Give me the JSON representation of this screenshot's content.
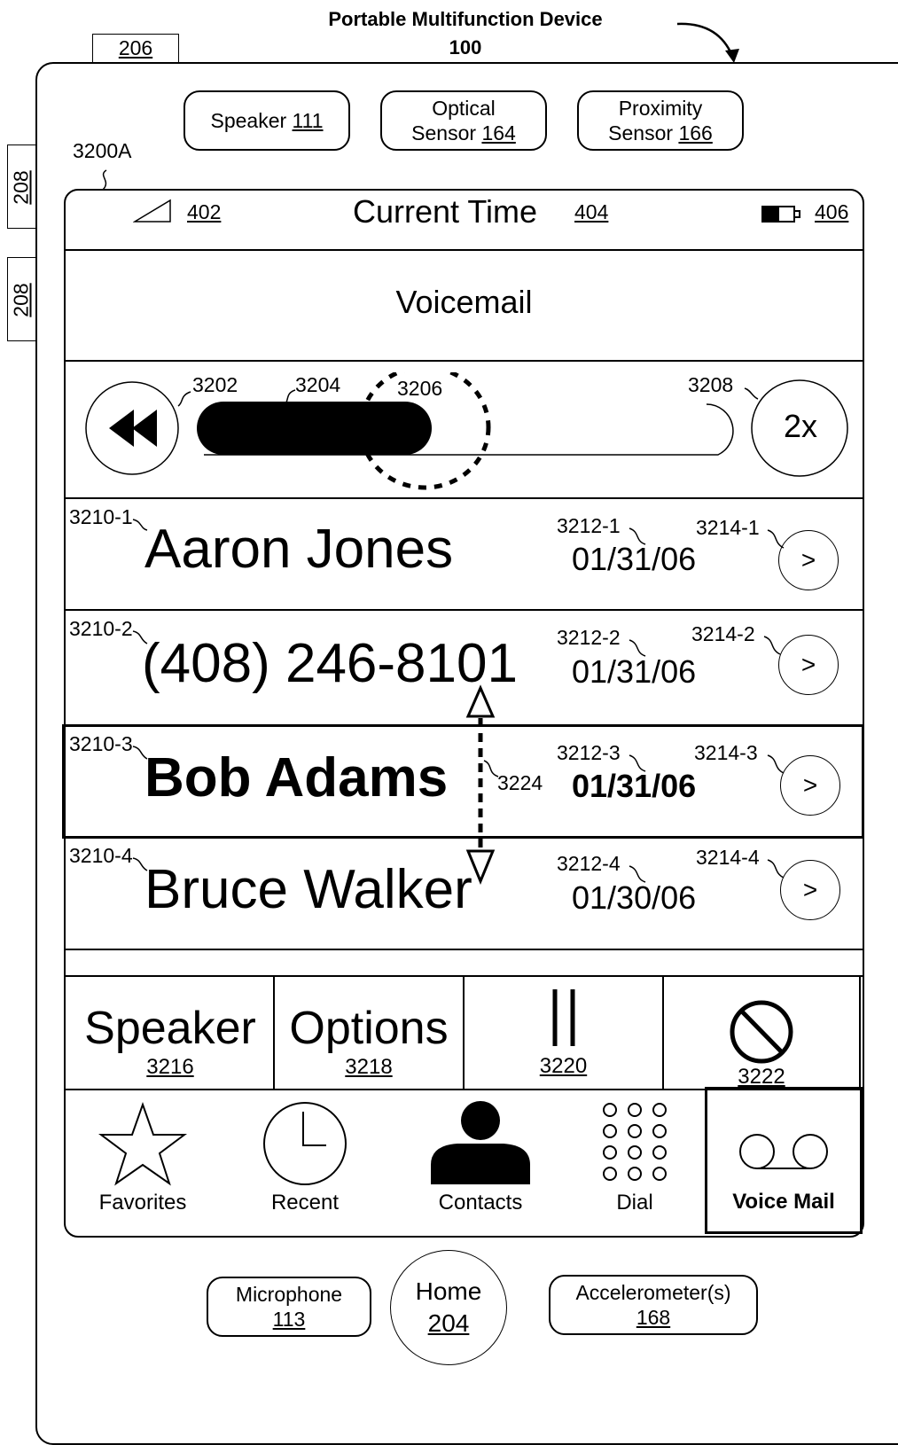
{
  "figure": {
    "title": "Portable Multifunction Device",
    "device_ref": "100",
    "ref_206": "206",
    "ref_208_a": "208",
    "ref_208_b": "208",
    "screen_ref": "3200A"
  },
  "hardware_top": [
    {
      "label": "Speaker",
      "ref": "111"
    },
    {
      "label": "Optical",
      "label2": "Sensor",
      "ref": "164"
    },
    {
      "label": "Proximity",
      "label2": "Sensor",
      "ref": "166"
    }
  ],
  "hardware_bottom": {
    "microphone": {
      "label": "Microphone",
      "ref": "113"
    },
    "home": {
      "label": "Home",
      "ref": "204"
    },
    "accelerometer": {
      "label": "Accelerometer(s)",
      "ref": "168"
    }
  },
  "status_bar": {
    "signal_ref": "402",
    "title": "Current Time",
    "title_ref": "404",
    "battery_ref": "406"
  },
  "header": {
    "title": "Voicemail"
  },
  "playback": {
    "rewind_ref": "3202",
    "progress_ref": "3204",
    "thumb_ref": "3206",
    "track_ref": "3208",
    "speed_label": "2x",
    "progress": 0.45
  },
  "messages": [
    {
      "ref": "3210-1",
      "name": "Aaron Jones",
      "date_ref": "3212-1",
      "date": "01/31/06",
      "btn_ref": "3214-1",
      "btn": ">",
      "selected": false
    },
    {
      "ref": "3210-2",
      "name": "(408) 246-8101",
      "date_ref": "3212-2",
      "date": "01/31/06",
      "btn_ref": "3214-2",
      "btn": ">",
      "selected": false
    },
    {
      "ref": "3210-3",
      "name": "Bob Adams",
      "date_ref": "3212-3",
      "date": "01/31/06",
      "btn_ref": "3214-3",
      "btn": ">",
      "selected": true
    },
    {
      "ref": "3210-4",
      "name": "Bruce Walker",
      "date_ref": "3212-4",
      "date": "01/30/06",
      "btn_ref": "3214-4",
      "btn": ">",
      "selected": false
    }
  ],
  "gesture_ref": "3224",
  "actions": [
    {
      "label": "Speaker",
      "ref": "3216"
    },
    {
      "label": "Options",
      "ref": "3218"
    },
    {
      "label": "",
      "ref": "3220",
      "icon": "pause-icon"
    },
    {
      "label": "",
      "ref": "3222",
      "icon": "prohibited-icon"
    }
  ],
  "tabs": [
    {
      "label": "Favorites",
      "icon": "star-icon"
    },
    {
      "label": "Recent",
      "icon": "clock-icon"
    },
    {
      "label": "Contacts",
      "icon": "person-icon"
    },
    {
      "label": "Dial",
      "icon": "keypad-icon"
    },
    {
      "label": "Voice Mail",
      "icon": "voicemail-icon",
      "selected": true
    }
  ]
}
